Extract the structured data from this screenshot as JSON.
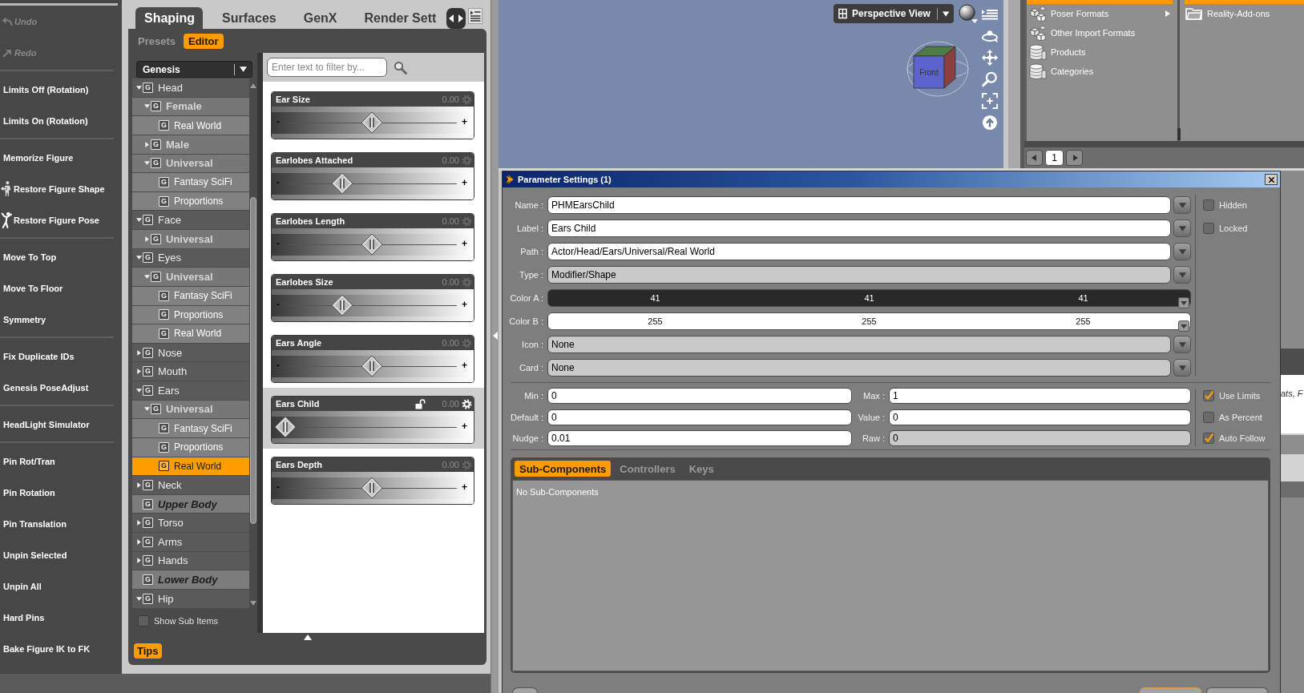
{
  "toolbar": {
    "groups": [
      [
        {
          "kind": "undo",
          "label": "Undo",
          "disabled": true
        },
        {
          "kind": "redo",
          "label": "Redo",
          "disabled": true
        }
      ],
      [
        {
          "kind": "text",
          "label": "Limits Off (Rotation)",
          "disabled": false
        },
        {
          "kind": "text",
          "label": "Limits On (Rotation)",
          "disabled": false
        }
      ],
      [
        {
          "kind": "text",
          "label": "Memorize Figure",
          "disabled": false
        },
        {
          "kind": "shape",
          "label": "Restore Figure Shape",
          "disabled": false
        },
        {
          "kind": "pose",
          "label": "Restore Figure Pose",
          "disabled": false
        }
      ],
      [
        {
          "kind": "text",
          "label": "Move To Top",
          "disabled": false
        },
        {
          "kind": "text",
          "label": "Move To Floor",
          "disabled": false
        },
        {
          "kind": "text",
          "label": "Symmetry",
          "disabled": false
        }
      ],
      [
        {
          "kind": "text",
          "label": "Fix Duplicate IDs",
          "disabled": false
        },
        {
          "kind": "text",
          "label": "Genesis PoseAdjust",
          "disabled": false
        }
      ],
      [
        {
          "kind": "text",
          "label": "HeadLight Simulator",
          "disabled": false
        }
      ],
      [
        {
          "kind": "text",
          "label": "Pin Rot/Tran",
          "disabled": false
        },
        {
          "kind": "text",
          "label": "Pin Rotation",
          "disabled": false
        },
        {
          "kind": "text",
          "label": "Pin Translation",
          "disabled": false
        },
        {
          "kind": "text",
          "label": "Unpin Selected",
          "disabled": false
        },
        {
          "kind": "text",
          "label": "Unpin All",
          "disabled": false
        },
        {
          "kind": "text",
          "label": "Hard Pins",
          "disabled": false
        },
        {
          "kind": "text",
          "label": "Bake Figure IK to FK",
          "disabled": false
        }
      ]
    ]
  },
  "shaping_pane": {
    "tabs": [
      {
        "label": "Shaping",
        "selected": true
      },
      {
        "label": "Surfaces",
        "selected": false
      },
      {
        "label": "GenX",
        "selected": false
      },
      {
        "label": "Render Sett",
        "selected": false
      }
    ],
    "subtabs": [
      {
        "label": "Presets",
        "selected": false
      },
      {
        "label": "Editor",
        "selected": true
      }
    ],
    "figure": "Genesis",
    "tree": [
      {
        "label": "Head",
        "badge": "G",
        "expanded": true,
        "selected": false,
        "disabled": false,
        "children": [
          {
            "label": "Female",
            "badge": "G",
            "expanded": true,
            "selected": false,
            "disabled": false,
            "children": [
              {
                "label": "Real World",
                "badge": "G",
                "selected": false,
                "disabled": false
              }
            ]
          },
          {
            "label": "Male",
            "badge": "G",
            "expanded": false,
            "selected": false,
            "disabled": false
          },
          {
            "label": "Universal",
            "badge": "G",
            "expanded": true,
            "selected": false,
            "disabled": false,
            "children": [
              {
                "label": "Fantasy SciFi",
                "badge": "G",
                "selected": false,
                "disabled": false
              },
              {
                "label": "Proportions",
                "badge": "G",
                "selected": false,
                "disabled": false
              }
            ]
          }
        ]
      },
      {
        "label": "Face",
        "badge": "G",
        "expanded": true,
        "selected": false,
        "disabled": false,
        "children": [
          {
            "label": "Universal",
            "badge": "G",
            "expanded": false,
            "selected": false,
            "disabled": false
          }
        ]
      },
      {
        "label": "Eyes",
        "badge": "G",
        "expanded": true,
        "selected": false,
        "disabled": false,
        "children": [
          {
            "label": "Universal",
            "badge": "G",
            "expanded": true,
            "selected": false,
            "disabled": false,
            "children": [
              {
                "label": "Fantasy SciFi",
                "badge": "G",
                "selected": false,
                "disabled": false
              },
              {
                "label": "Proportions",
                "badge": "G",
                "selected": false,
                "disabled": false
              },
              {
                "label": "Real World",
                "badge": "G",
                "selected": false,
                "disabled": false
              }
            ]
          }
        ]
      },
      {
        "label": "Nose",
        "badge": "G",
        "expanded": false,
        "selected": false,
        "disabled": false
      },
      {
        "label": "Mouth",
        "badge": "G",
        "expanded": false,
        "selected": false,
        "disabled": false
      },
      {
        "label": "Ears",
        "badge": "G",
        "expanded": true,
        "selected": false,
        "disabled": false,
        "children": [
          {
            "label": "Universal",
            "badge": "G",
            "expanded": true,
            "selected": false,
            "disabled": false,
            "children": [
              {
                "label": "Fantasy SciFi",
                "badge": "G",
                "selected": false,
                "disabled": false
              },
              {
                "label": "Proportions",
                "badge": "G",
                "selected": false,
                "disabled": false
              },
              {
                "label": "Real World",
                "badge": "G",
                "selected": true,
                "disabled": false
              }
            ]
          }
        ]
      },
      {
        "label": "Neck",
        "badge": "G",
        "expanded": false,
        "selected": false,
        "disabled": false
      },
      {
        "label": "Upper Body",
        "badge": "G",
        "selected": false,
        "disabled": true
      },
      {
        "label": "Torso",
        "badge": "G",
        "expanded": false,
        "selected": false,
        "disabled": false
      },
      {
        "label": "Arms",
        "badge": "G",
        "expanded": false,
        "selected": false,
        "disabled": false
      },
      {
        "label": "Hands",
        "badge": "G",
        "expanded": false,
        "selected": false,
        "disabled": false
      },
      {
        "label": "Lower Body",
        "badge": "G",
        "selected": false,
        "disabled": true
      },
      {
        "label": "Hip",
        "badge": "G",
        "expanded": true,
        "selected": false,
        "disabled": false
      }
    ],
    "show_sub_items": {
      "label": "Show Sub Items",
      "checked": false
    },
    "filter": {
      "placeholder": "Enter text to filter by..."
    },
    "sliders": [
      {
        "name": "Ear Size",
        "value": "0.00",
        "min_sign": "-",
        "max_sign": "+",
        "level": 0.5,
        "selected": false
      },
      {
        "name": "Earlobes Attached",
        "value": "0.00",
        "min_sign": "-",
        "max_sign": "+",
        "level": 0.33,
        "selected": false
      },
      {
        "name": "Earlobes Length",
        "value": "0.00",
        "min_sign": "-",
        "max_sign": "+",
        "level": 0.5,
        "selected": false
      },
      {
        "name": "Earlobes Size",
        "value": "0.00",
        "min_sign": "-",
        "max_sign": "+",
        "level": 0.33,
        "selected": false
      },
      {
        "name": "Ears Angle",
        "value": "0.00",
        "min_sign": "-",
        "max_sign": "+",
        "level": 0.5,
        "selected": false
      },
      {
        "name": "Ears Child",
        "value": "0.00",
        "max_sign": "+",
        "level": 0,
        "selected": true
      },
      {
        "name": "Ears Depth",
        "value": "0.00",
        "min_sign": "-",
        "max_sign": "+",
        "level": 0.5,
        "selected": false
      }
    ],
    "tips": "Tips"
  },
  "viewport": {
    "view": "Perspective View",
    "cube_label": "Front"
  },
  "content_library": {
    "items": [
      {
        "kind": "boxes",
        "label": "Poser Formats",
        "has_submenu": true
      },
      {
        "kind": "boxes",
        "label": "Other Import Formats",
        "has_submenu": false
      },
      {
        "kind": "stack",
        "label": "Products",
        "has_submenu": false
      },
      {
        "kind": "stack",
        "label": "Categories",
        "has_submenu": false
      }
    ],
    "side_items": [
      {
        "kind": "folder",
        "label": "Reality-Add-ons"
      }
    ],
    "page": "1"
  },
  "parameter_dialog": {
    "title": "Parameter Settings (1)",
    "fields": [
      {
        "kind": "text",
        "label": "Name :",
        "value": "PHMEarsChild",
        "disabled": false
      },
      {
        "kind": "text",
        "label": "Label :",
        "value": "Ears Child",
        "disabled": false
      },
      {
        "kind": "text",
        "label": "Path :",
        "value": "Actor/Head/Ears/Universal/Real World",
        "disabled": false
      },
      {
        "kind": "text",
        "label": "Type :",
        "value": "Modifier/Shape",
        "disabled": true
      },
      {
        "kind": "color",
        "label": "Color A :",
        "values": [
          "41",
          "41",
          "41"
        ],
        "color": "#292929"
      },
      {
        "kind": "color",
        "label": "Color B :",
        "values": [
          "255",
          "255",
          "255"
        ],
        "color": "#ffffff"
      },
      {
        "kind": "text",
        "label": "Icon :",
        "value": "None",
        "disabled": true
      },
      {
        "kind": "text",
        "label": "Card :",
        "value": "None",
        "disabled": true
      }
    ],
    "flags": [
      {
        "label": "Hidden",
        "checked": false
      },
      {
        "label": "Locked",
        "checked": false
      }
    ],
    "limits": [
      {
        "label": "Min :",
        "value": "0",
        "disabled": false
      },
      {
        "label": "Max :",
        "value": "1",
        "disabled": false
      },
      {
        "label": "Default :",
        "value": "0",
        "disabled": false
      },
      {
        "label": "Value :",
        "value": "0",
        "disabled": false
      },
      {
        "label": "Nudge :",
        "value": "0.01",
        "disabled": false
      },
      {
        "label": "Raw :",
        "value": "0",
        "disabled": true
      }
    ],
    "limit_flags": [
      {
        "label": "Use Limits",
        "checked": true
      },
      {
        "label": "As Percent",
        "checked": false
      },
      {
        "label": "Auto Follow",
        "checked": true
      }
    ],
    "tabs": [
      {
        "label": "Sub-Components",
        "selected": true
      },
      {
        "label": "Controllers",
        "selected": false
      },
      {
        "label": "Keys",
        "selected": false
      }
    ],
    "message": "No Sub-Components"
  },
  "background_panel": {
    "text": "ats, F"
  }
}
